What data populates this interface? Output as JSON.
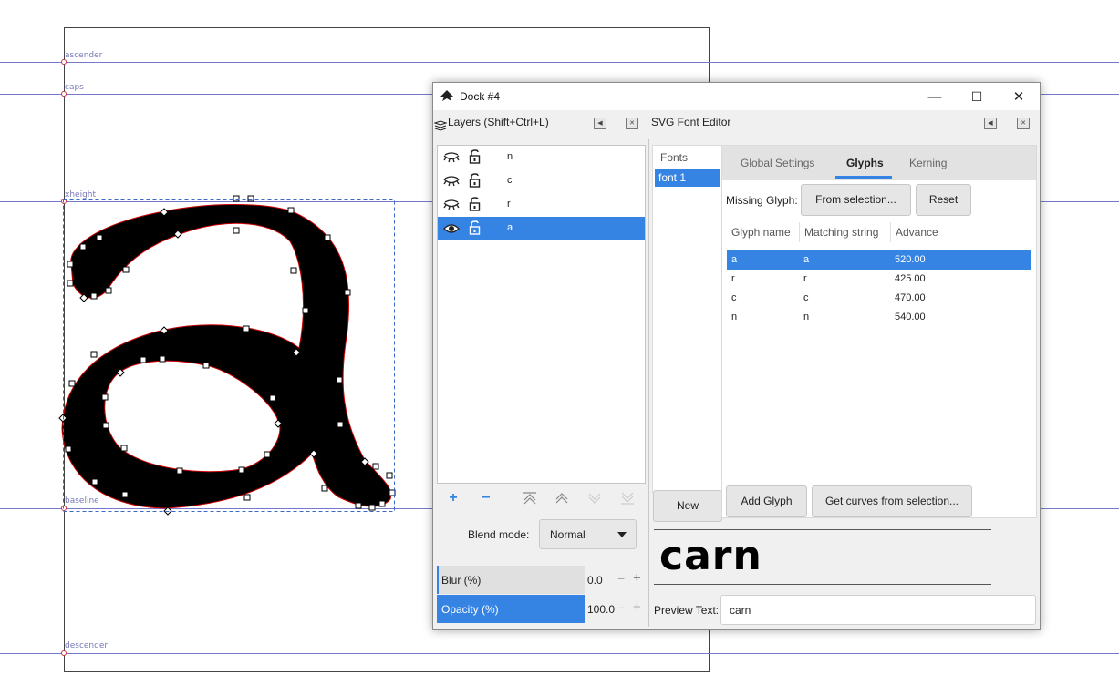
{
  "canvas": {
    "guides": [
      "ascender",
      "caps",
      "xheight",
      "baseline",
      "descender"
    ]
  },
  "dock": {
    "title": "Dock #4",
    "window_buttons": {
      "minimize": "—",
      "maximize": "☐",
      "close": "✕"
    }
  },
  "layers_panel": {
    "title": "Layers (Shift+Ctrl+L)",
    "layers": [
      {
        "name": "n",
        "visible": false,
        "selected": false
      },
      {
        "name": "c",
        "visible": false,
        "selected": false
      },
      {
        "name": "r",
        "visible": false,
        "selected": false
      },
      {
        "name": "a",
        "visible": true,
        "selected": true
      }
    ],
    "blend_mode_label": "Blend mode:",
    "blend_mode_value": "Normal",
    "blur_label": "Blur (%)",
    "blur_value": "0.0",
    "blur_fraction": 0.0,
    "opacity_label": "Opacity (%)",
    "opacity_value": "100.0",
    "opacity_fraction": 1.0
  },
  "font_editor": {
    "title": "SVG Font Editor",
    "fonts_header": "Fonts",
    "fonts": [
      "font 1"
    ],
    "new_button": "New",
    "tabs": [
      "Global Settings",
      "Glyphs",
      "Kerning"
    ],
    "active_tab": "Glyphs",
    "missing_glyph_label": "Missing Glyph:",
    "from_selection_button": "From selection...",
    "reset_button": "Reset",
    "columns": [
      "Glyph name",
      "Matching string",
      "Advance"
    ],
    "glyphs": [
      {
        "name": "a",
        "match": "a",
        "advance": "520.00"
      },
      {
        "name": "r",
        "match": "r",
        "advance": "425.00"
      },
      {
        "name": "c",
        "match": "c",
        "advance": "470.00"
      },
      {
        "name": "n",
        "match": "n",
        "advance": "540.00"
      }
    ],
    "add_glyph_button": "Add Glyph",
    "get_curves_button": "Get curves from selection...",
    "preview_rendered": "carn",
    "preview_text_label": "Preview Text:",
    "preview_text_value": "carn"
  },
  "colors": {
    "accent": "#3584e4",
    "guide": "#7777cc",
    "path_outline": "#cc0000"
  }
}
